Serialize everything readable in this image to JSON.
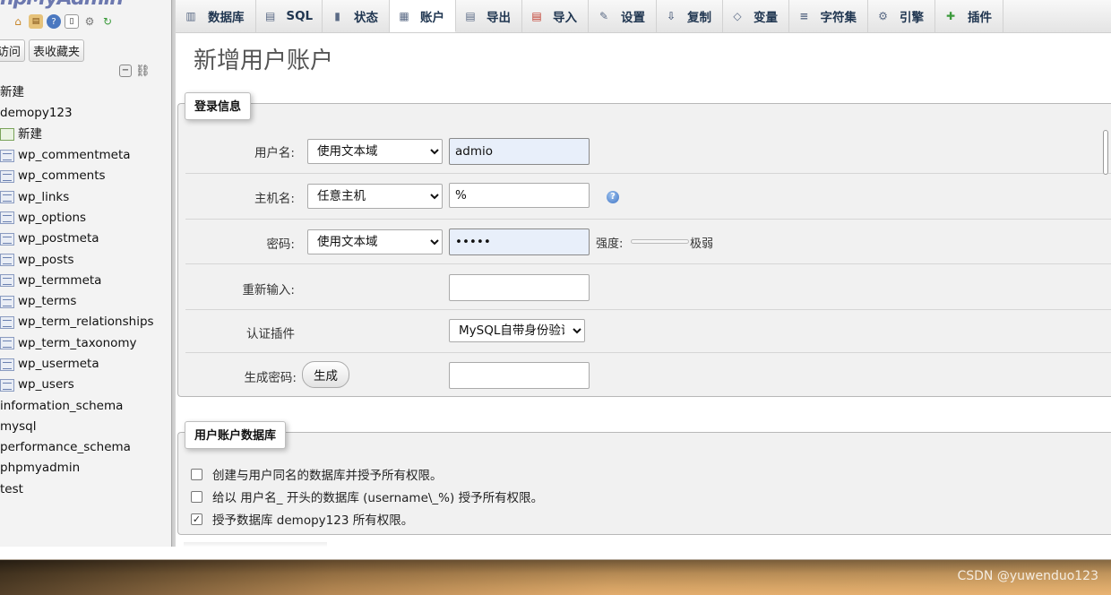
{
  "sidebar": {
    "logo_main": "hp",
    "logo_accent": "MyAdmin",
    "icons": [
      "home-icon",
      "sql-icon",
      "help-icon",
      "docs-icon",
      "settings-icon",
      "reload-icon"
    ],
    "nav_tabs": [
      "访问",
      "表收藏夹"
    ],
    "tree": [
      {
        "label": "新建",
        "type": "root"
      },
      {
        "label": "demopy123",
        "type": "root"
      },
      {
        "label": "新建",
        "type": "new"
      },
      {
        "label": "wp_commentmeta",
        "type": "table"
      },
      {
        "label": "wp_comments",
        "type": "table"
      },
      {
        "label": "wp_links",
        "type": "table"
      },
      {
        "label": "wp_options",
        "type": "table"
      },
      {
        "label": "wp_postmeta",
        "type": "table"
      },
      {
        "label": "wp_posts",
        "type": "table"
      },
      {
        "label": "wp_termmeta",
        "type": "table"
      },
      {
        "label": "wp_terms",
        "type": "table"
      },
      {
        "label": "wp_term_relationships",
        "type": "table"
      },
      {
        "label": "wp_term_taxonomy",
        "type": "table"
      },
      {
        "label": "wp_usermeta",
        "type": "table"
      },
      {
        "label": "wp_users",
        "type": "table"
      },
      {
        "label": "information_schema",
        "type": "root"
      },
      {
        "label": "mysql",
        "type": "root"
      },
      {
        "label": "performance_schema",
        "type": "root"
      },
      {
        "label": "phpmyadmin",
        "type": "root"
      },
      {
        "label": "test",
        "type": "root"
      }
    ]
  },
  "tabs": [
    {
      "label": "数据库",
      "icon": "database-icon",
      "active": false
    },
    {
      "label": "SQL",
      "icon": "sql-icon",
      "active": false
    },
    {
      "label": "状态",
      "icon": "status-icon",
      "active": false
    },
    {
      "label": "账户",
      "icon": "accounts-icon",
      "active": true
    },
    {
      "label": "导出",
      "icon": "export-icon",
      "active": false
    },
    {
      "label": "导入",
      "icon": "import-icon",
      "active": false
    },
    {
      "label": "设置",
      "icon": "wrench-icon",
      "active": false
    },
    {
      "label": "复制",
      "icon": "replication-icon",
      "active": false
    },
    {
      "label": "变量",
      "icon": "variables-icon",
      "active": false
    },
    {
      "label": "字符集",
      "icon": "charset-icon",
      "active": false
    },
    {
      "label": "引擎",
      "icon": "engine-icon",
      "active": false
    },
    {
      "label": "插件",
      "icon": "plugin-icon",
      "active": false
    }
  ],
  "page": {
    "title": "新增用户账户"
  },
  "login": {
    "legend": "登录信息",
    "username_label": "用户名:",
    "username_mode": "使用文本域",
    "username_value": "admio",
    "host_label": "主机名:",
    "host_mode": "任意主机",
    "host_value": "%",
    "password_label": "密码:",
    "password_mode": "使用文本域",
    "password_value": "•••••",
    "strength_label": "强度:",
    "strength_text": "极弱",
    "strength_level": 0,
    "reenter_label": "重新输入:",
    "auth_label": "认证插件",
    "auth_value": "MySQL自带身份验证",
    "generate_label": "生成密码:",
    "generate_button": "生成"
  },
  "userdb": {
    "legend": "用户账户数据库",
    "options": [
      {
        "label": "创建与用户同名的数据库并授予所有权限。",
        "checked": false
      },
      {
        "label": "给以 用户名_ 开头的数据库 (username\\_%) 授予所有权限。",
        "checked": false
      },
      {
        "label": "授予数据库 demopy123 所有权限。",
        "checked": true
      }
    ]
  },
  "watermark": "CSDN @yuwenduo123"
}
